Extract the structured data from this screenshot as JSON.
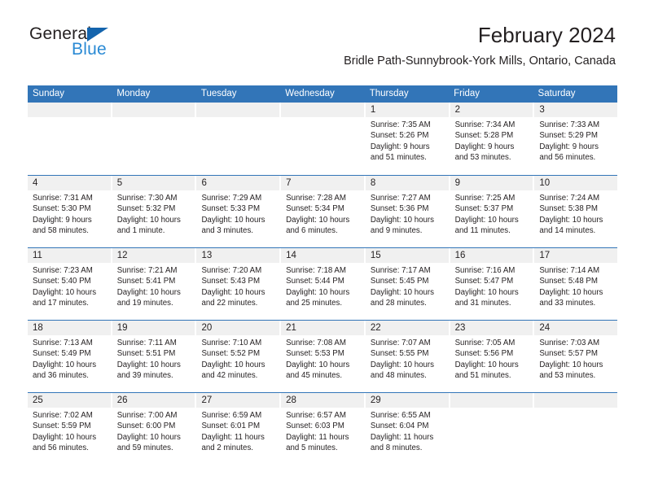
{
  "brand": {
    "name_part1": "General",
    "name_part2": "Blue",
    "triangle_icon": "triangle-icon",
    "color_dark": "#231f20",
    "color_blue": "#2a8ad4",
    "color_triangle": "#1464ad"
  },
  "header": {
    "title": "February 2024",
    "subtitle": "Bridle Path-Sunnybrook-York Mills, Ontario, Canada"
  },
  "theme": {
    "header_blue": "#3275b8",
    "band_gray": "#f0f0f0",
    "text": "#231f20"
  },
  "calendar": {
    "weekday_headers": [
      "Sunday",
      "Monday",
      "Tuesday",
      "Wednesday",
      "Thursday",
      "Friday",
      "Saturday"
    ],
    "weeks": [
      [
        {
          "day": "",
          "sunrise": "",
          "sunset": "",
          "daylight_line1": "",
          "daylight_line2": ""
        },
        {
          "day": "",
          "sunrise": "",
          "sunset": "",
          "daylight_line1": "",
          "daylight_line2": ""
        },
        {
          "day": "",
          "sunrise": "",
          "sunset": "",
          "daylight_line1": "",
          "daylight_line2": ""
        },
        {
          "day": "",
          "sunrise": "",
          "sunset": "",
          "daylight_line1": "",
          "daylight_line2": ""
        },
        {
          "day": "1",
          "sunrise": "Sunrise: 7:35 AM",
          "sunset": "Sunset: 5:26 PM",
          "daylight_line1": "Daylight: 9 hours",
          "daylight_line2": "and 51 minutes."
        },
        {
          "day": "2",
          "sunrise": "Sunrise: 7:34 AM",
          "sunset": "Sunset: 5:28 PM",
          "daylight_line1": "Daylight: 9 hours",
          "daylight_line2": "and 53 minutes."
        },
        {
          "day": "3",
          "sunrise": "Sunrise: 7:33 AM",
          "sunset": "Sunset: 5:29 PM",
          "daylight_line1": "Daylight: 9 hours",
          "daylight_line2": "and 56 minutes."
        }
      ],
      [
        {
          "day": "4",
          "sunrise": "Sunrise: 7:31 AM",
          "sunset": "Sunset: 5:30 PM",
          "daylight_line1": "Daylight: 9 hours",
          "daylight_line2": "and 58 minutes."
        },
        {
          "day": "5",
          "sunrise": "Sunrise: 7:30 AM",
          "sunset": "Sunset: 5:32 PM",
          "daylight_line1": "Daylight: 10 hours",
          "daylight_line2": "and 1 minute."
        },
        {
          "day": "6",
          "sunrise": "Sunrise: 7:29 AM",
          "sunset": "Sunset: 5:33 PM",
          "daylight_line1": "Daylight: 10 hours",
          "daylight_line2": "and 3 minutes."
        },
        {
          "day": "7",
          "sunrise": "Sunrise: 7:28 AM",
          "sunset": "Sunset: 5:34 PM",
          "daylight_line1": "Daylight: 10 hours",
          "daylight_line2": "and 6 minutes."
        },
        {
          "day": "8",
          "sunrise": "Sunrise: 7:27 AM",
          "sunset": "Sunset: 5:36 PM",
          "daylight_line1": "Daylight: 10 hours",
          "daylight_line2": "and 9 minutes."
        },
        {
          "day": "9",
          "sunrise": "Sunrise: 7:25 AM",
          "sunset": "Sunset: 5:37 PM",
          "daylight_line1": "Daylight: 10 hours",
          "daylight_line2": "and 11 minutes."
        },
        {
          "day": "10",
          "sunrise": "Sunrise: 7:24 AM",
          "sunset": "Sunset: 5:38 PM",
          "daylight_line1": "Daylight: 10 hours",
          "daylight_line2": "and 14 minutes."
        }
      ],
      [
        {
          "day": "11",
          "sunrise": "Sunrise: 7:23 AM",
          "sunset": "Sunset: 5:40 PM",
          "daylight_line1": "Daylight: 10 hours",
          "daylight_line2": "and 17 minutes."
        },
        {
          "day": "12",
          "sunrise": "Sunrise: 7:21 AM",
          "sunset": "Sunset: 5:41 PM",
          "daylight_line1": "Daylight: 10 hours",
          "daylight_line2": "and 19 minutes."
        },
        {
          "day": "13",
          "sunrise": "Sunrise: 7:20 AM",
          "sunset": "Sunset: 5:43 PM",
          "daylight_line1": "Daylight: 10 hours",
          "daylight_line2": "and 22 minutes."
        },
        {
          "day": "14",
          "sunrise": "Sunrise: 7:18 AM",
          "sunset": "Sunset: 5:44 PM",
          "daylight_line1": "Daylight: 10 hours",
          "daylight_line2": "and 25 minutes."
        },
        {
          "day": "15",
          "sunrise": "Sunrise: 7:17 AM",
          "sunset": "Sunset: 5:45 PM",
          "daylight_line1": "Daylight: 10 hours",
          "daylight_line2": "and 28 minutes."
        },
        {
          "day": "16",
          "sunrise": "Sunrise: 7:16 AM",
          "sunset": "Sunset: 5:47 PM",
          "daylight_line1": "Daylight: 10 hours",
          "daylight_line2": "and 31 minutes."
        },
        {
          "day": "17",
          "sunrise": "Sunrise: 7:14 AM",
          "sunset": "Sunset: 5:48 PM",
          "daylight_line1": "Daylight: 10 hours",
          "daylight_line2": "and 33 minutes."
        }
      ],
      [
        {
          "day": "18",
          "sunrise": "Sunrise: 7:13 AM",
          "sunset": "Sunset: 5:49 PM",
          "daylight_line1": "Daylight: 10 hours",
          "daylight_line2": "and 36 minutes."
        },
        {
          "day": "19",
          "sunrise": "Sunrise: 7:11 AM",
          "sunset": "Sunset: 5:51 PM",
          "daylight_line1": "Daylight: 10 hours",
          "daylight_line2": "and 39 minutes."
        },
        {
          "day": "20",
          "sunrise": "Sunrise: 7:10 AM",
          "sunset": "Sunset: 5:52 PM",
          "daylight_line1": "Daylight: 10 hours",
          "daylight_line2": "and 42 minutes."
        },
        {
          "day": "21",
          "sunrise": "Sunrise: 7:08 AM",
          "sunset": "Sunset: 5:53 PM",
          "daylight_line1": "Daylight: 10 hours",
          "daylight_line2": "and 45 minutes."
        },
        {
          "day": "22",
          "sunrise": "Sunrise: 7:07 AM",
          "sunset": "Sunset: 5:55 PM",
          "daylight_line1": "Daylight: 10 hours",
          "daylight_line2": "and 48 minutes."
        },
        {
          "day": "23",
          "sunrise": "Sunrise: 7:05 AM",
          "sunset": "Sunset: 5:56 PM",
          "daylight_line1": "Daylight: 10 hours",
          "daylight_line2": "and 51 minutes."
        },
        {
          "day": "24",
          "sunrise": "Sunrise: 7:03 AM",
          "sunset": "Sunset: 5:57 PM",
          "daylight_line1": "Daylight: 10 hours",
          "daylight_line2": "and 53 minutes."
        }
      ],
      [
        {
          "day": "25",
          "sunrise": "Sunrise: 7:02 AM",
          "sunset": "Sunset: 5:59 PM",
          "daylight_line1": "Daylight: 10 hours",
          "daylight_line2": "and 56 minutes."
        },
        {
          "day": "26",
          "sunrise": "Sunrise: 7:00 AM",
          "sunset": "Sunset: 6:00 PM",
          "daylight_line1": "Daylight: 10 hours",
          "daylight_line2": "and 59 minutes."
        },
        {
          "day": "27",
          "sunrise": "Sunrise: 6:59 AM",
          "sunset": "Sunset: 6:01 PM",
          "daylight_line1": "Daylight: 11 hours",
          "daylight_line2": "and 2 minutes."
        },
        {
          "day": "28",
          "sunrise": "Sunrise: 6:57 AM",
          "sunset": "Sunset: 6:03 PM",
          "daylight_line1": "Daylight: 11 hours",
          "daylight_line2": "and 5 minutes."
        },
        {
          "day": "29",
          "sunrise": "Sunrise: 6:55 AM",
          "sunset": "Sunset: 6:04 PM",
          "daylight_line1": "Daylight: 11 hours",
          "daylight_line2": "and 8 minutes."
        },
        {
          "day": "",
          "sunrise": "",
          "sunset": "",
          "daylight_line1": "",
          "daylight_line2": ""
        },
        {
          "day": "",
          "sunrise": "",
          "sunset": "",
          "daylight_line1": "",
          "daylight_line2": ""
        }
      ]
    ]
  }
}
